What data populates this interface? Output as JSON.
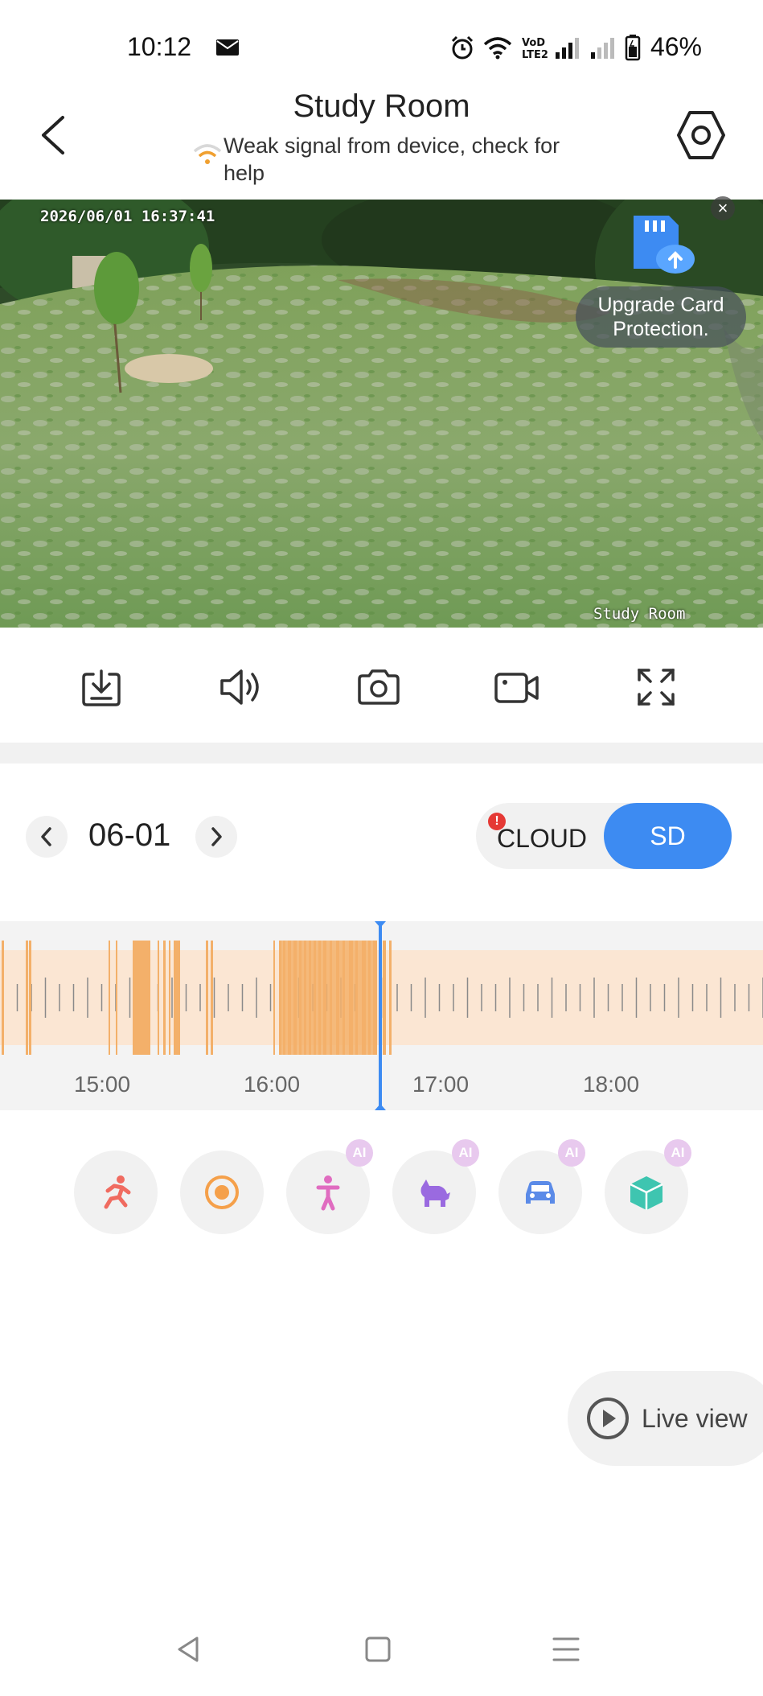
{
  "status_bar": {
    "time": "10:12",
    "battery": "46%",
    "icons": [
      "mail-icon",
      "alarm-icon",
      "wifi-icon",
      "volte-icon",
      "signal-icon",
      "signal-weak-icon",
      "battery-icon"
    ]
  },
  "header": {
    "title": "Study Room",
    "signal_warning": "Weak signal from device, check for help"
  },
  "video": {
    "timestamp": "2026/06/01 16:37:41",
    "camera_label": "Study Room",
    "promo": {
      "text": "Upgrade Card Protection.",
      "close": "×"
    }
  },
  "toolbar": {
    "icons": [
      "download-icon",
      "speaker-icon",
      "camera-icon",
      "record-icon",
      "fullscreen-icon"
    ]
  },
  "date_row": {
    "date": "06-01",
    "cloud_label": "CLOUD",
    "sd_label": "SD",
    "cloud_alert": "!",
    "selected_source": "SD"
  },
  "timeline": {
    "hour_labels": [
      "15:00",
      "16:00",
      "17:00",
      "18:00"
    ],
    "current_time": "16:37:41",
    "accent": "#3d8bf2",
    "recording_color": "#f3b06a"
  },
  "event_filters": [
    {
      "name": "motion",
      "icon": "running-person-icon",
      "ai": false,
      "color": "#f06b60"
    },
    {
      "name": "sound",
      "icon": "target-icon",
      "ai": false,
      "color": "#f5a04a"
    },
    {
      "name": "person",
      "icon": "person-icon",
      "ai": true,
      "color": "#e06cc0"
    },
    {
      "name": "pet",
      "icon": "pet-icon",
      "ai": true,
      "color": "#9a6ae0"
    },
    {
      "name": "vehicle",
      "icon": "car-icon",
      "ai": true,
      "color": "#5b8be8"
    },
    {
      "name": "package",
      "icon": "package-icon",
      "ai": true,
      "color": "#3ec5b0"
    }
  ],
  "ai_badge": "AI",
  "live_view": {
    "label": "Live view"
  },
  "nav_bar": {
    "icons": [
      "back-nav-icon",
      "home-nav-icon",
      "recents-nav-icon"
    ]
  }
}
